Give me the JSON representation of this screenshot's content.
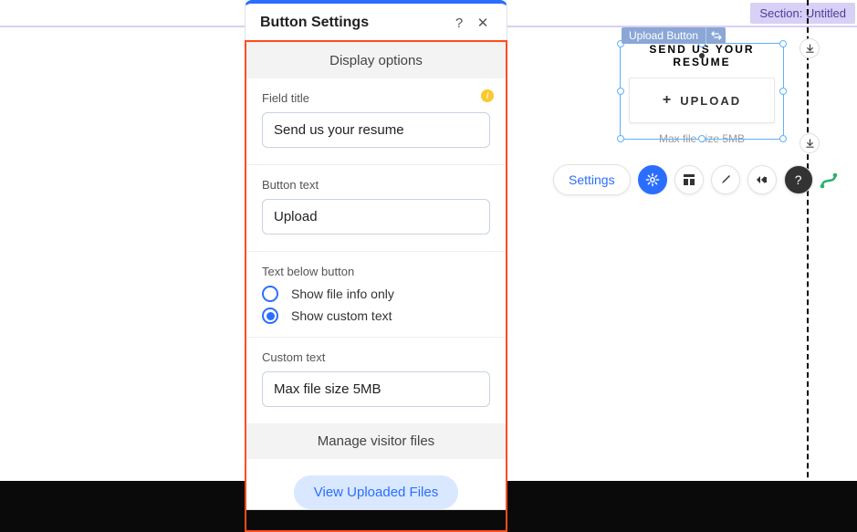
{
  "section_tag": "Section: Untitled",
  "panel": {
    "title": "Button Settings",
    "display_options_header": "Display options",
    "field_title": {
      "label": "Field title",
      "value": "Send us your resume"
    },
    "button_text": {
      "label": "Button text",
      "value": "Upload"
    },
    "text_below": {
      "label": "Text below button",
      "options": [
        "Show file info only",
        "Show custom text"
      ],
      "selected": 1
    },
    "custom_text": {
      "label": "Custom text",
      "value": "Max file size 5MB"
    },
    "manage_header": "Manage visitor files",
    "view_uploaded_label": "View Uploaded Files"
  },
  "widget": {
    "tag": "Upload Button",
    "title": "SEND US YOUR RESUME",
    "button": "UPLOAD",
    "caption": "Max file size 5MB"
  },
  "toolbar": {
    "settings": "Settings"
  }
}
